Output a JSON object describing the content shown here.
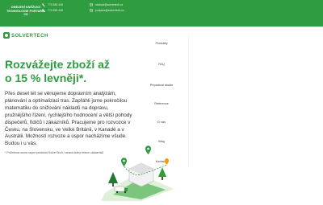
{
  "topbar": {
    "company_lines": [
      "OMEZENÍ KNĚŽIJICÍ",
      "TECHNOLOGIE PORTARIA",
      "CS"
    ],
    "contacts": [
      {
        "icon": "phone-icon",
        "text": "774 845 445"
      },
      {
        "icon": "phone-icon",
        "text": "774 845 446"
      },
      {
        "icon": "mail-icon",
        "text": "obchod@solvertech.cz"
      },
      {
        "icon": "mail-icon",
        "text": "podpora@solvertech.cz"
      }
    ]
  },
  "logo": {
    "text": "SOLVERTECH"
  },
  "nav": [
    "Produkty",
    "FAQ",
    "Případové studie",
    "Reference",
    "O nás",
    "Blog",
    "Kontakty"
  ],
  "hero": {
    "headline_line1": "Rozvážejte zboží až",
    "headline_line2": "o 15 % levněji*.",
    "body": "Přes deset let se věnujeme dopravním analýzám, plánování a optimalizaci tras. Zapřáhli jsme pokročilou matematiku do snižování nákladů na dopravu, pružnějšího řízení, rychlejšího hodnocení a větší pohody dispečerů, řidičů i zákazníků. Pracujeme pro rozvozce v Česku, na Slovensku, ve Velké Británii, v Kanadě a v Austrálii. Možností rozvoze a úspor nacházíme všude. Budou i u vás.",
    "footnote": "* Průměrná suma úspor produktu SolverTech / ceska dráhy řešení zákazníků"
  },
  "colors": {
    "brand_green": "#2f9c3f",
    "text_dark": "#2f2f2f"
  }
}
